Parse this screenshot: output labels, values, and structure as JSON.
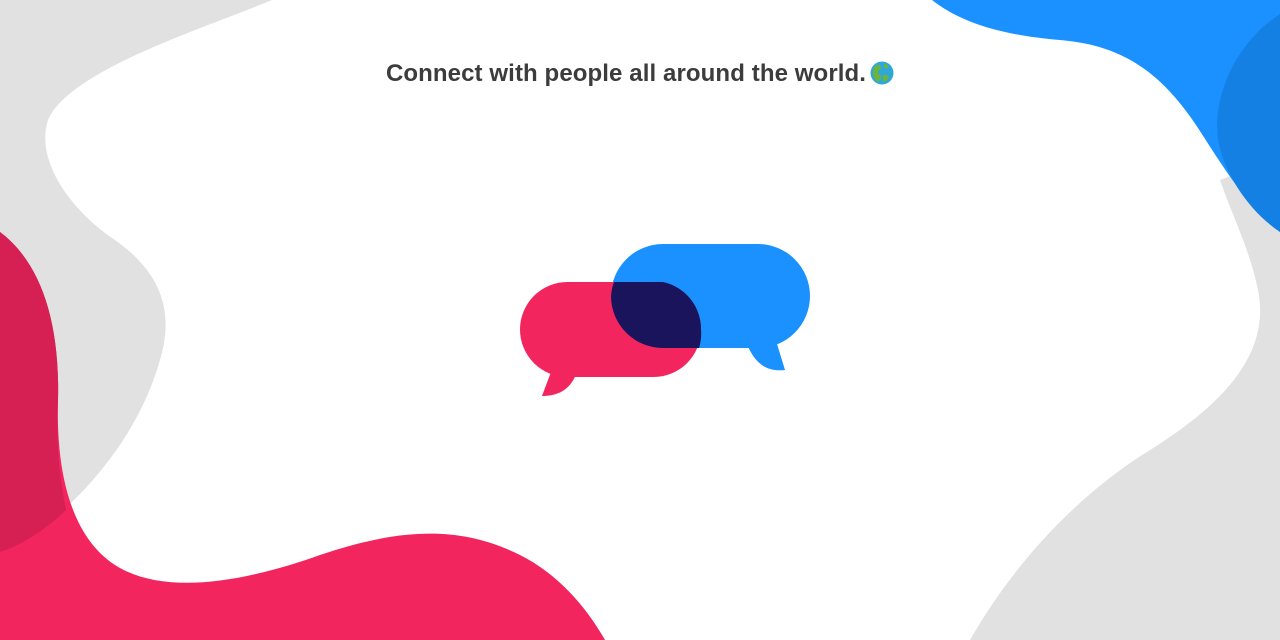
{
  "tagline": {
    "text": "Connect with people all around the world.",
    "icon": "globe-americas-icon"
  },
  "logo": {
    "icon": "overlapping-chat-bubbles-icon"
  },
  "colors": {
    "background": "#ffffff",
    "blob_gray": "#e1e1e1",
    "blob_red": "#f3255e",
    "blob_red_dark": "#d61f52",
    "blob_blue": "#1a91ff",
    "blob_blue_dark": "#1580e4",
    "bubble_overlap": "#19145c",
    "text": "#3c3c3c"
  }
}
